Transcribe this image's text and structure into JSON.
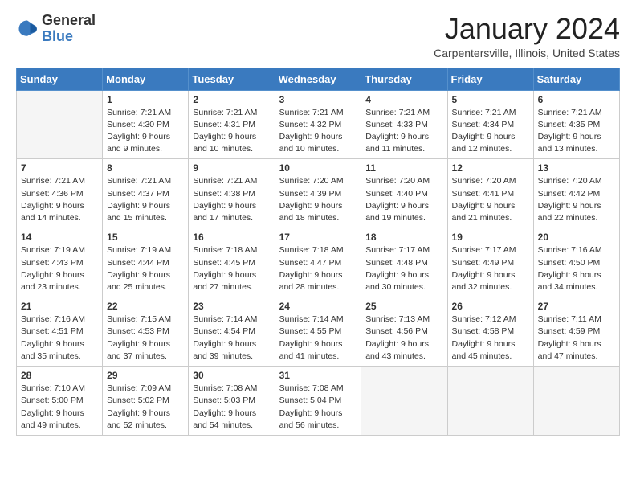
{
  "header": {
    "logo": {
      "general": "General",
      "blue": "Blue"
    },
    "title": "January 2024",
    "location": "Carpentersville, Illinois, United States"
  },
  "weekdays": [
    "Sunday",
    "Monday",
    "Tuesday",
    "Wednesday",
    "Thursday",
    "Friday",
    "Saturday"
  ],
  "weeks": [
    [
      {
        "day": null
      },
      {
        "day": "1",
        "sunrise": "7:21 AM",
        "sunset": "4:30 PM",
        "daylight": "9 hours and 9 minutes."
      },
      {
        "day": "2",
        "sunrise": "7:21 AM",
        "sunset": "4:31 PM",
        "daylight": "9 hours and 10 minutes."
      },
      {
        "day": "3",
        "sunrise": "7:21 AM",
        "sunset": "4:32 PM",
        "daylight": "9 hours and 10 minutes."
      },
      {
        "day": "4",
        "sunrise": "7:21 AM",
        "sunset": "4:33 PM",
        "daylight": "9 hours and 11 minutes."
      },
      {
        "day": "5",
        "sunrise": "7:21 AM",
        "sunset": "4:34 PM",
        "daylight": "9 hours and 12 minutes."
      },
      {
        "day": "6",
        "sunrise": "7:21 AM",
        "sunset": "4:35 PM",
        "daylight": "9 hours and 13 minutes."
      }
    ],
    [
      {
        "day": "7",
        "sunrise": "7:21 AM",
        "sunset": "4:36 PM",
        "daylight": "9 hours and 14 minutes."
      },
      {
        "day": "8",
        "sunrise": "7:21 AM",
        "sunset": "4:37 PM",
        "daylight": "9 hours and 15 minutes."
      },
      {
        "day": "9",
        "sunrise": "7:21 AM",
        "sunset": "4:38 PM",
        "daylight": "9 hours and 17 minutes."
      },
      {
        "day": "10",
        "sunrise": "7:20 AM",
        "sunset": "4:39 PM",
        "daylight": "9 hours and 18 minutes."
      },
      {
        "day": "11",
        "sunrise": "7:20 AM",
        "sunset": "4:40 PM",
        "daylight": "9 hours and 19 minutes."
      },
      {
        "day": "12",
        "sunrise": "7:20 AM",
        "sunset": "4:41 PM",
        "daylight": "9 hours and 21 minutes."
      },
      {
        "day": "13",
        "sunrise": "7:20 AM",
        "sunset": "4:42 PM",
        "daylight": "9 hours and 22 minutes."
      }
    ],
    [
      {
        "day": "14",
        "sunrise": "7:19 AM",
        "sunset": "4:43 PM",
        "daylight": "9 hours and 23 minutes."
      },
      {
        "day": "15",
        "sunrise": "7:19 AM",
        "sunset": "4:44 PM",
        "daylight": "9 hours and 25 minutes."
      },
      {
        "day": "16",
        "sunrise": "7:18 AM",
        "sunset": "4:45 PM",
        "daylight": "9 hours and 27 minutes."
      },
      {
        "day": "17",
        "sunrise": "7:18 AM",
        "sunset": "4:47 PM",
        "daylight": "9 hours and 28 minutes."
      },
      {
        "day": "18",
        "sunrise": "7:17 AM",
        "sunset": "4:48 PM",
        "daylight": "9 hours and 30 minutes."
      },
      {
        "day": "19",
        "sunrise": "7:17 AM",
        "sunset": "4:49 PM",
        "daylight": "9 hours and 32 minutes."
      },
      {
        "day": "20",
        "sunrise": "7:16 AM",
        "sunset": "4:50 PM",
        "daylight": "9 hours and 34 minutes."
      }
    ],
    [
      {
        "day": "21",
        "sunrise": "7:16 AM",
        "sunset": "4:51 PM",
        "daylight": "9 hours and 35 minutes."
      },
      {
        "day": "22",
        "sunrise": "7:15 AM",
        "sunset": "4:53 PM",
        "daylight": "9 hours and 37 minutes."
      },
      {
        "day": "23",
        "sunrise": "7:14 AM",
        "sunset": "4:54 PM",
        "daylight": "9 hours and 39 minutes."
      },
      {
        "day": "24",
        "sunrise": "7:14 AM",
        "sunset": "4:55 PM",
        "daylight": "9 hours and 41 minutes."
      },
      {
        "day": "25",
        "sunrise": "7:13 AM",
        "sunset": "4:56 PM",
        "daylight": "9 hours and 43 minutes."
      },
      {
        "day": "26",
        "sunrise": "7:12 AM",
        "sunset": "4:58 PM",
        "daylight": "9 hours and 45 minutes."
      },
      {
        "day": "27",
        "sunrise": "7:11 AM",
        "sunset": "4:59 PM",
        "daylight": "9 hours and 47 minutes."
      }
    ],
    [
      {
        "day": "28",
        "sunrise": "7:10 AM",
        "sunset": "5:00 PM",
        "daylight": "9 hours and 49 minutes."
      },
      {
        "day": "29",
        "sunrise": "7:09 AM",
        "sunset": "5:02 PM",
        "daylight": "9 hours and 52 minutes."
      },
      {
        "day": "30",
        "sunrise": "7:08 AM",
        "sunset": "5:03 PM",
        "daylight": "9 hours and 54 minutes."
      },
      {
        "day": "31",
        "sunrise": "7:08 AM",
        "sunset": "5:04 PM",
        "daylight": "9 hours and 56 minutes."
      },
      {
        "day": null
      },
      {
        "day": null
      },
      {
        "day": null
      }
    ]
  ],
  "labels": {
    "sunrise": "Sunrise:",
    "sunset": "Sunset:",
    "daylight": "Daylight:"
  }
}
